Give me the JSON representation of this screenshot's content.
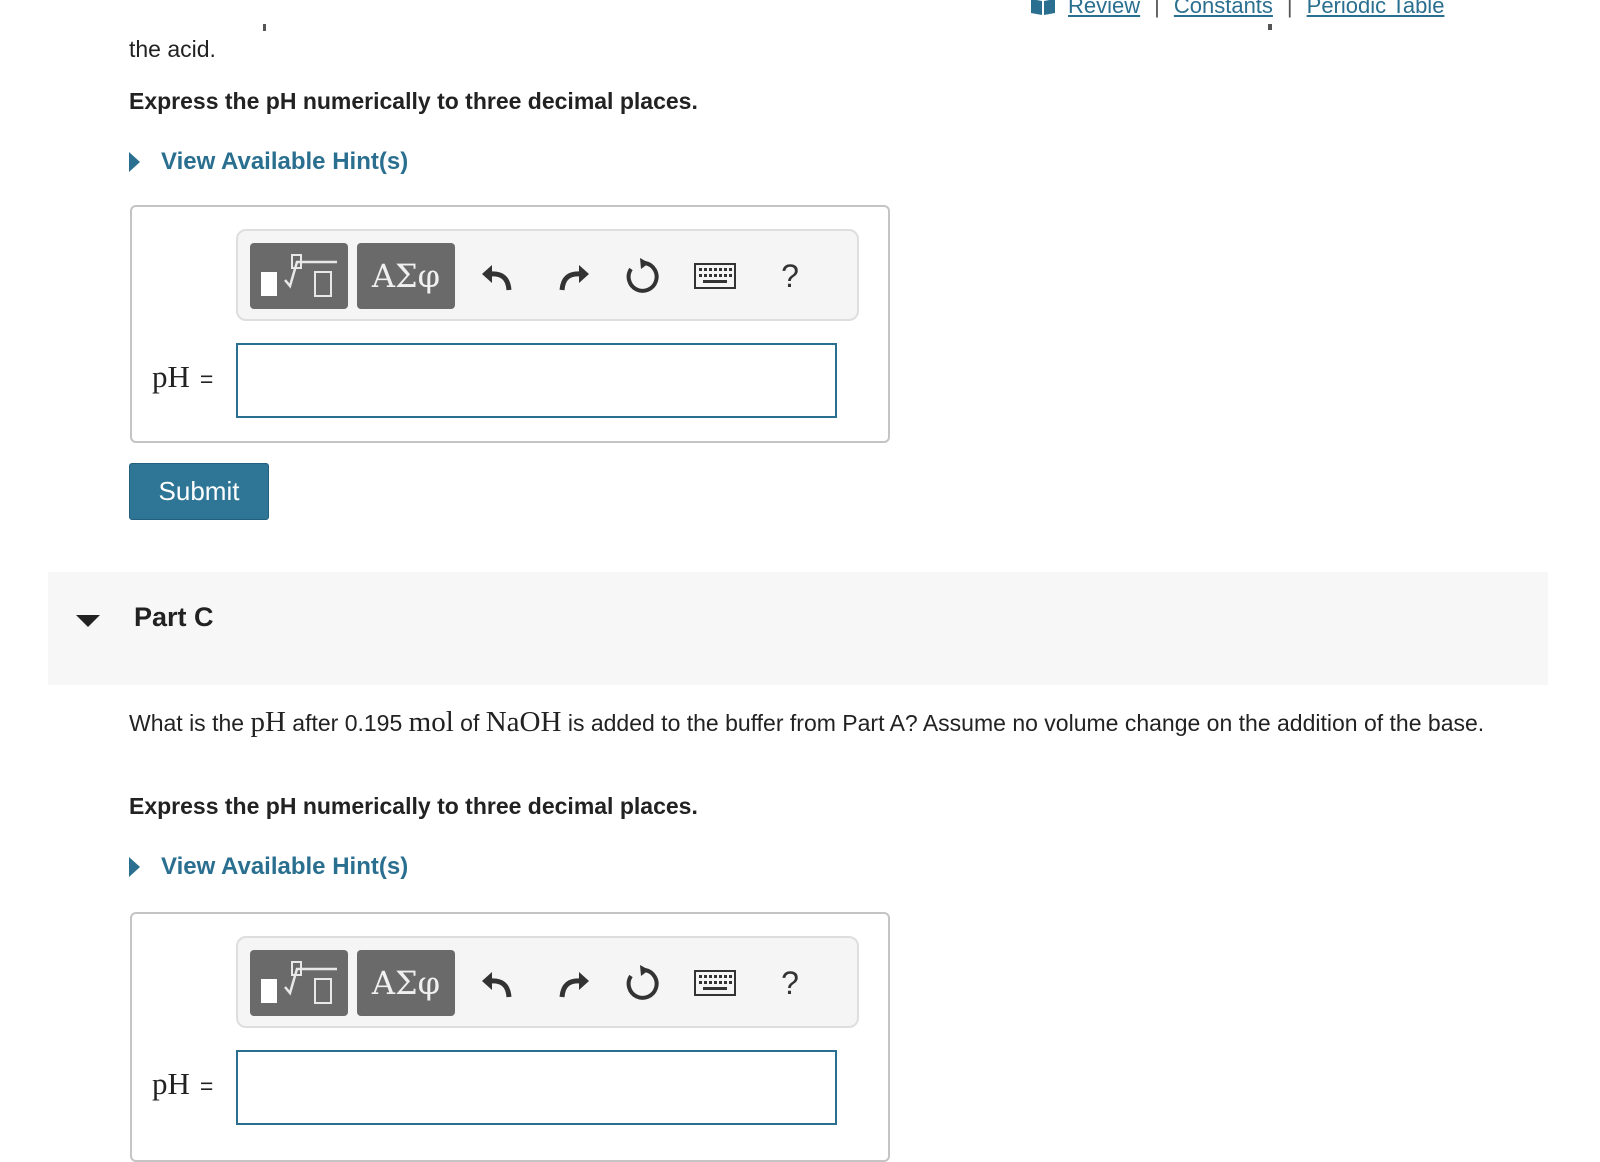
{
  "header_links": {
    "review": "Review",
    "separator": "|",
    "constants": "Constants",
    "periodic_table": "Periodic Table"
  },
  "part_b": {
    "question_tail": "the acid.",
    "instruction": "Express the pH numerically to three decimal places.",
    "hints_label": "View Available Hint(s)",
    "answer_label": "pH",
    "equals": "=",
    "input_value": "",
    "submit_label": "Submit"
  },
  "part_c": {
    "title": "Part C",
    "question": {
      "t1": "What is the ",
      "m1": "pH",
      "t2": " after 0.195 ",
      "m2": "mol",
      "t3": " of ",
      "m3": "NaOH",
      "t4": " is added to the buffer from Part A? Assume no volume change on the addition of the base."
    },
    "instruction": "Express the pH numerically to three decimal places.",
    "hints_label": "View Available Hint(s)",
    "answer_label": "pH",
    "equals": "=",
    "input_value": ""
  },
  "toolbar": {
    "symbols_label": "ΑΣφ",
    "help_label": "?",
    "icons": [
      "templates-icon",
      "undo-icon",
      "redo-icon",
      "reset-icon",
      "keyboard-icon",
      "help-icon"
    ]
  },
  "colors": {
    "link": "#2a6f8f",
    "submit_bg": "#2e7596",
    "toolbar_button": "#6a6a6a",
    "part_header_bg": "#f7f7f7"
  }
}
